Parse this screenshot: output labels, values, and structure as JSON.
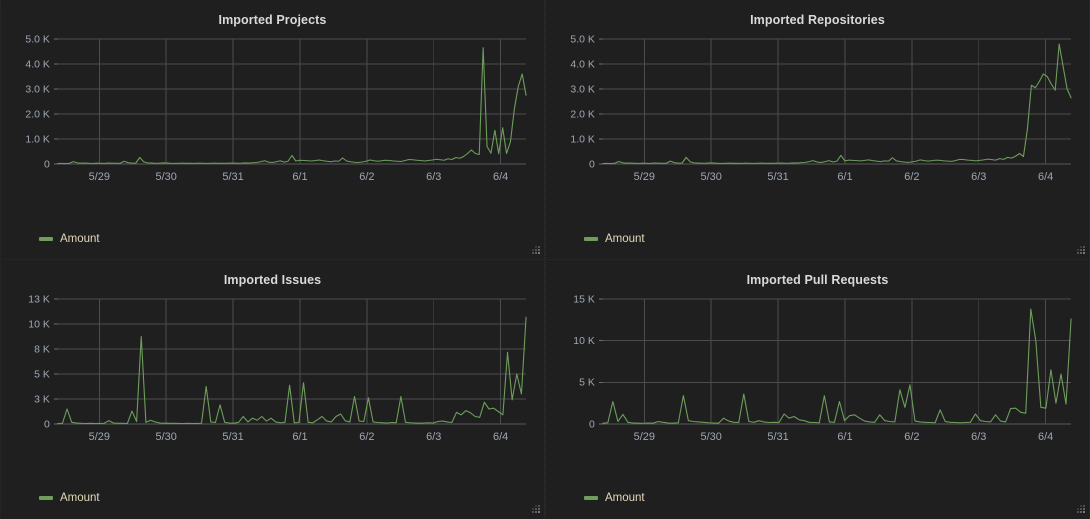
{
  "theme": {
    "page_background": "#161719",
    "panel_background": "#1f1f20",
    "series_color": "#6d9e5b",
    "grid_color": "#4c4c4e",
    "title_color": "#d8d9da",
    "axis_text_color": "#9fa7b3",
    "legend_text_color": "#e3d8b5"
  },
  "legend_label": "Amount",
  "panels": [
    {
      "id": "imported-projects",
      "title": "Imported Projects",
      "chart_data": {
        "type": "line",
        "title": "Imported Projects",
        "xlabel": "",
        "ylabel": "",
        "grid": true,
        "legend_position": "bottom-left",
        "ylim": [
          0,
          5000
        ],
        "ytick_labels": [
          "0",
          "1.0 K",
          "2.0 K",
          "3.0 K",
          "4.0 K",
          "5.0 K"
        ],
        "ytick_values": [
          0,
          1000,
          2000,
          3000,
          4000,
          5000
        ],
        "xtick_labels": [
          "5/29",
          "5/30",
          "5/31",
          "6/1",
          "6/2",
          "6/3",
          "6/4"
        ],
        "series": [
          {
            "name": "Amount",
            "color": "#6d9e5b",
            "values": [
              20,
              25,
              18,
              30,
              95,
              45,
              35,
              40,
              30,
              25,
              35,
              30,
              25,
              40,
              35,
              28,
              30,
              110,
              55,
              35,
              40,
              260,
              90,
              45,
              40,
              30,
              35,
              45,
              40,
              30,
              25,
              30,
              35,
              28,
              30,
              25,
              35,
              30,
              25,
              30,
              35,
              30,
              28,
              30,
              35,
              40,
              30,
              35,
              45,
              40,
              50,
              60,
              90,
              130,
              75,
              60,
              90,
              130,
              75,
              110,
              340,
              120,
              150,
              140,
              130,
              120,
              140,
              160,
              130,
              110,
              90,
              120,
              110,
              240,
              120,
              90,
              70,
              60,
              80,
              110,
              160,
              130,
              110,
              130,
              150,
              140,
              120,
              110,
              100,
              140,
              180,
              170,
              150,
              140,
              120,
              140,
              160,
              190,
              170,
              150,
              210,
              180,
              260,
              230,
              300,
              420,
              560,
              420,
              380,
              4650,
              700,
              430,
              1350,
              410,
              1450,
              420,
              900,
              2200,
              3100,
              3600,
              2750
            ]
          }
        ]
      }
    },
    {
      "id": "imported-repositories",
      "title": "Imported Repositories",
      "chart_data": {
        "type": "line",
        "title": "Imported Repositories",
        "xlabel": "",
        "ylabel": "",
        "grid": true,
        "legend_position": "bottom-left",
        "ylim": [
          0,
          5000
        ],
        "ytick_labels": [
          "0",
          "1.0 K",
          "2.0 K",
          "3.0 K",
          "4.0 K",
          "5.0 K"
        ],
        "ytick_values": [
          0,
          1000,
          2000,
          3000,
          4000,
          5000
        ],
        "xtick_labels": [
          "5/29",
          "5/30",
          "5/31",
          "6/1",
          "6/2",
          "6/3",
          "6/4"
        ],
        "series": [
          {
            "name": "Amount",
            "color": "#6d9e5b",
            "values": [
              20,
              25,
              18,
              30,
              100,
              50,
              35,
              40,
              30,
              25,
              35,
              30,
              25,
              40,
              35,
              28,
              30,
              115,
              55,
              35,
              40,
              265,
              90,
              45,
              40,
              30,
              35,
              45,
              40,
              30,
              25,
              30,
              35,
              28,
              30,
              25,
              35,
              30,
              25,
              30,
              35,
              30,
              28,
              30,
              35,
              40,
              30,
              35,
              45,
              40,
              55,
              65,
              95,
              135,
              80,
              60,
              95,
              135,
              80,
              115,
              345,
              125,
              155,
              145,
              135,
              125,
              145,
              165,
              135,
              115,
              95,
              125,
              115,
              250,
              125,
              95,
              75,
              65,
              85,
              115,
              165,
              135,
              115,
              135,
              155,
              145,
              125,
              115,
              105,
              145,
              185,
              175,
              155,
              145,
              125,
              145,
              165,
              195,
              175,
              155,
              215,
              185,
              265,
              235,
              310,
              420,
              300,
              1400,
              3150,
              3050,
              3300,
              3600,
              3500,
              3200,
              2950,
              4800,
              3900,
              3000,
              2650
            ]
          }
        ]
      }
    },
    {
      "id": "imported-issues",
      "title": "Imported Issues",
      "chart_data": {
        "type": "line",
        "title": "Imported Issues",
        "xlabel": "",
        "ylabel": "",
        "grid": true,
        "legend_position": "bottom-left",
        "ylim": [
          0,
          13000
        ],
        "ytick_labels": [
          "0",
          "3 K",
          "5 K",
          "8 K",
          "10 K",
          "13 K"
        ],
        "ytick_values": [
          0,
          3000,
          5000,
          8000,
          10000,
          13000
        ],
        "xtick_labels": [
          "5/29",
          "5/30",
          "5/31",
          "6/1",
          "6/2",
          "6/3",
          "6/4"
        ],
        "series": [
          {
            "name": "Amount",
            "color": "#6d9e5b",
            "values": [
              60,
              80,
              1800,
              200,
              120,
              80,
              60,
              80,
              60,
              70,
              90,
              400,
              120,
              90,
              80,
              60,
              1550,
              300,
              9000,
              200,
              450,
              250,
              120,
              100,
              80,
              90,
              70,
              60,
              80,
              60,
              70,
              90,
              4000,
              250,
              180,
              2300,
              200,
              120,
              100,
              200,
              900,
              250,
              700,
              450,
              900,
              350,
              700,
              250,
              150,
              200,
              4100,
              150,
              180,
              4300,
              200,
              150,
              500,
              900,
              350,
              250,
              900,
              1200,
              380,
              250,
              3200,
              350,
              300,
              3100,
              250,
              180,
              150,
              120,
              180,
              160,
              3200,
              200,
              150,
              120,
              100,
              120,
              150,
              120,
              300,
              350,
              250,
              180,
              1400,
              1100,
              1600,
              1350,
              900,
              800,
              2600,
              1800,
              1900,
              1500,
              1100,
              7600,
              2900,
              5000,
              3400,
              10800
            ]
          }
        ]
      }
    },
    {
      "id": "imported-pull-requests",
      "title": "Imported Pull Requests",
      "chart_data": {
        "type": "line",
        "title": "Imported Pull Requests",
        "xlabel": "",
        "ylabel": "",
        "grid": true,
        "legend_position": "bottom-left",
        "ylim": [
          0,
          15000
        ],
        "ytick_labels": [
          "0",
          "5 K",
          "10 K",
          "15 K"
        ],
        "ytick_values": [
          0,
          5000,
          10000,
          15000
        ],
        "xtick_labels": [
          "5/29",
          "5/30",
          "5/31",
          "6/1",
          "6/2",
          "6/3",
          "6/4"
        ],
        "series": [
          {
            "name": "Amount",
            "color": "#6d9e5b",
            "values": [
              80,
              150,
              2700,
              300,
              1150,
              200,
              120,
              100,
              90,
              120,
              100,
              300,
              200,
              120,
              100,
              150,
              3400,
              400,
              300,
              250,
              200,
              150,
              120,
              100,
              700,
              350,
              200,
              180,
              3600,
              300,
              200,
              400,
              250,
              180,
              200,
              180,
              1200,
              700,
              900,
              500,
              400,
              200,
              180,
              150,
              3400,
              250,
              200,
              2700,
              400,
              1000,
              1100,
              700,
              350,
              250,
              200,
              1100,
              400,
              300,
              250,
              4100,
              2000,
              4700,
              350,
              250,
              200,
              180,
              150,
              1700,
              300,
              200,
              180,
              150,
              180,
              200,
              1200,
              400,
              300,
              250,
              1100,
              350,
              250,
              1850,
              1900,
              1400,
              1300,
              13800,
              10000,
              2000,
              1900,
              6500,
              2500,
              6000,
              2400,
              12600
            ]
          }
        ]
      }
    }
  ]
}
